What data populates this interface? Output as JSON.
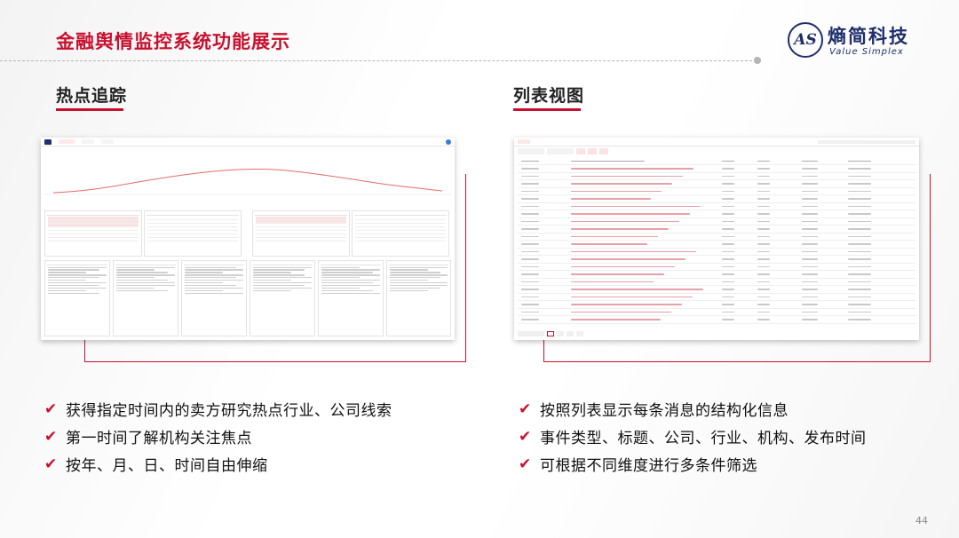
{
  "slide": {
    "title": "金融舆情监控系统功能展示",
    "page_number": "44"
  },
  "logo": {
    "mark": "AS",
    "name": "熵简科技",
    "subtitle": "Value Simplex"
  },
  "sections": {
    "left": {
      "title": "热点追踪",
      "bullets": [
        "获得指定时间内的卖方研究热点行业、公司线索",
        "第一时间了解机构关注焦点",
        "按年、月、日、时间自由伸缩"
      ]
    },
    "right": {
      "title": "列表视图",
      "bullets": [
        "按照列表显示每条消息的结构化信息",
        "事件类型、标题、公司、行业、机构、发布时间",
        "可根据不同维度进行多条件筛选"
      ]
    }
  },
  "colors": {
    "accent": "#c8102e",
    "brand": "#1f2f6b",
    "highlight_row": "#fbe3e5"
  },
  "icons": {
    "check": "check-icon",
    "logo": "value-simplex-logo-icon"
  }
}
